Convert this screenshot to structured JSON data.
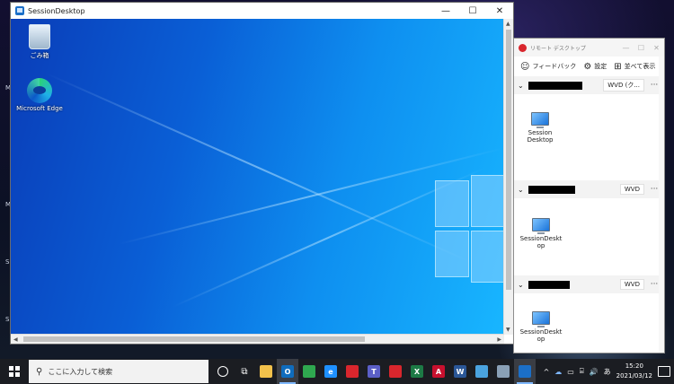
{
  "session_window": {
    "title": "SessionDesktop",
    "controls": {
      "minimize": "—",
      "maximize": "☐",
      "close": "✕"
    },
    "desktop_icons": [
      {
        "label": "ごみ箱"
      },
      {
        "label": "Microsoft Edge"
      }
    ]
  },
  "host_edge_labels": [
    "M",
    "M",
    "S",
    "S"
  ],
  "rd_client": {
    "title": "リモート デスクトップ",
    "controls": {
      "minimize": "—",
      "maximize": "☐",
      "close": "✕"
    },
    "toolbar": {
      "feedback": "フィードバック",
      "settings": "設定",
      "tile_view": "並べて表示"
    },
    "groups": [
      {
        "tag": "WVD (ク...",
        "resource": "Session Desktop"
      },
      {
        "tag": "WVD",
        "resource": "SessionDesktop"
      },
      {
        "tag": "WVD",
        "resource": "SessionDesktop"
      }
    ],
    "more_label": "···"
  },
  "taskbar": {
    "search_placeholder": "ここに入力して検索",
    "time": "15:20",
    "date": "2021/03/12",
    "tray_chevron": "^",
    "ime": "あ",
    "volume": "🔊",
    "apps": [
      {
        "icon": "file-explorer-icon",
        "glyph": "",
        "color": "#f2c14b"
      },
      {
        "icon": "outlook-icon",
        "glyph": "O",
        "color": "#0f6cbd",
        "active": true
      },
      {
        "icon": "chrome-icon",
        "glyph": "",
        "color": "#2fa84f"
      },
      {
        "icon": "internet-explorer-icon",
        "glyph": "e",
        "color": "#1e90ff"
      },
      {
        "icon": "remote-desktop-icon",
        "glyph": "",
        "color": "#d9262d"
      },
      {
        "icon": "teams-icon",
        "glyph": "T",
        "color": "#5b5fc7"
      },
      {
        "icon": "shield-icon",
        "glyph": "",
        "color": "#d9262d"
      },
      {
        "icon": "excel-icon",
        "glyph": "X",
        "color": "#1d7a45"
      },
      {
        "icon": "acrobat-icon",
        "glyph": "A",
        "color": "#c8102e"
      },
      {
        "icon": "word-icon",
        "glyph": "W",
        "color": "#2b5797"
      },
      {
        "icon": "photos-icon",
        "glyph": "",
        "color": "#4aa3df"
      },
      {
        "icon": "tools-icon",
        "glyph": "",
        "color": "#8aa0b6"
      },
      {
        "icon": "session-desktop-icon",
        "glyph": "",
        "color": "#1b6fc8",
        "active": true
      }
    ]
  }
}
